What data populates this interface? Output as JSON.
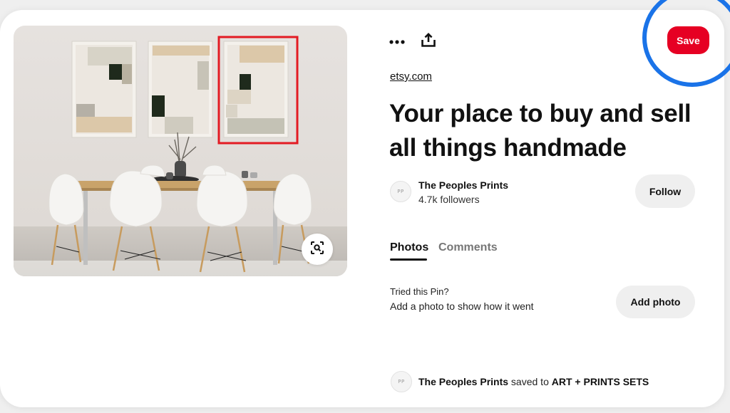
{
  "actions": {
    "save_label": "Save",
    "more_icon": "more-horizontal-icon",
    "share_icon": "share-upload-icon",
    "lens_icon": "visual-search-icon"
  },
  "pin": {
    "source": "etsy.com",
    "title": "Your place to buy and sell all things handmade"
  },
  "creator": {
    "name": "The Peoples Prints",
    "followers": "4.7k followers",
    "follow_label": "Follow",
    "avatar_text": "PP"
  },
  "tabs": [
    {
      "label": "Photos",
      "active": true
    },
    {
      "label": "Comments",
      "active": false
    }
  ],
  "tried": {
    "title": "Tried this Pin?",
    "subtitle": "Add a photo to show how it went",
    "button_label": "Add photo"
  },
  "saved": {
    "user": "The Peoples Prints",
    "mid": " saved to ",
    "board": "ART + PRINTS SETS"
  },
  "colors": {
    "save_red": "#e60023",
    "ring_blue": "#1a73e8",
    "crop_highlight_red": "#e31b23"
  }
}
